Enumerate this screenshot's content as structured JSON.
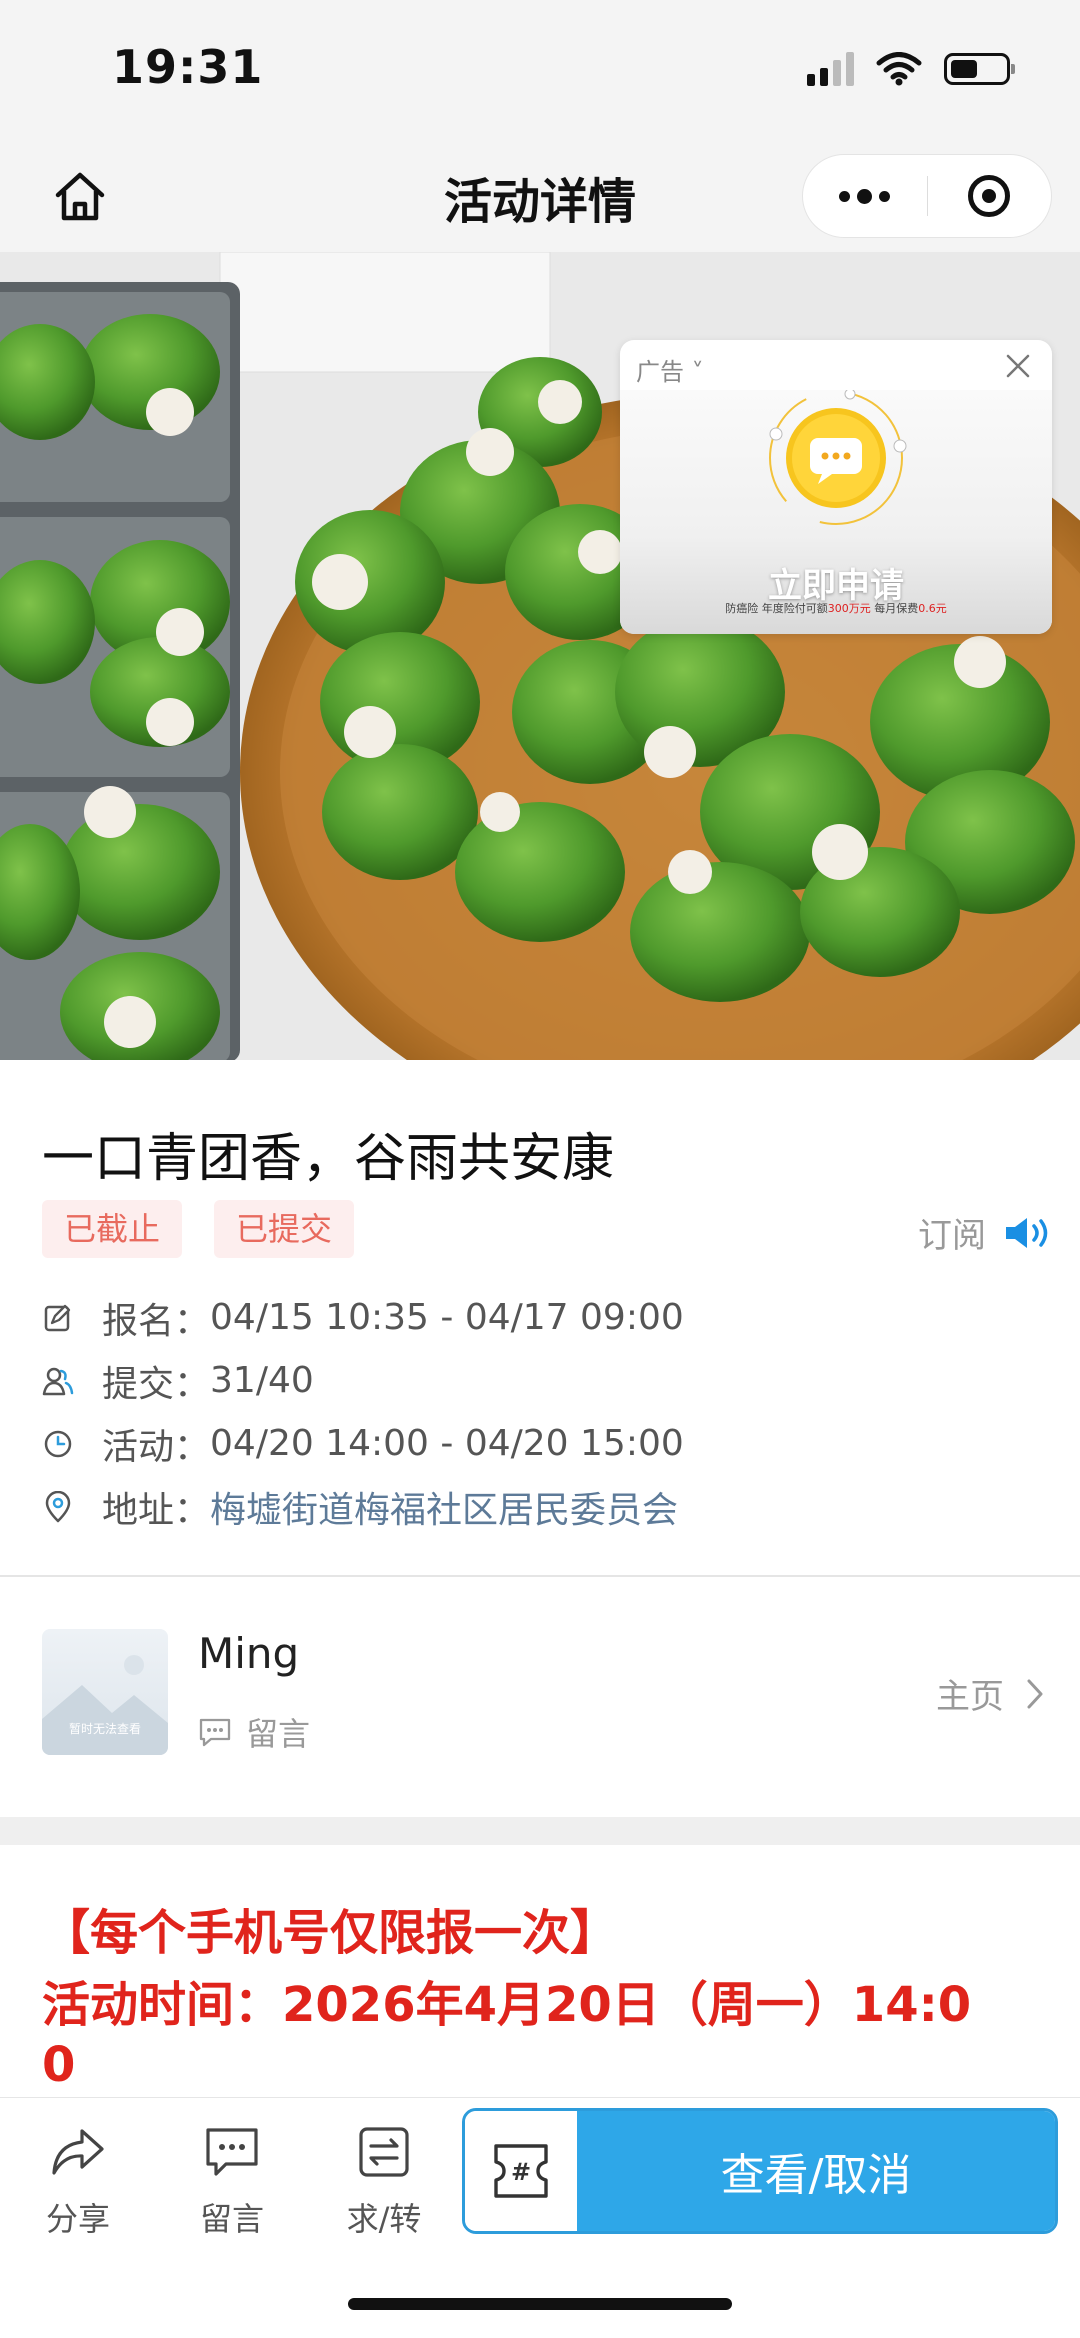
{
  "status_bar": {
    "time": "19:31"
  },
  "nav": {
    "title": "活动详情"
  },
  "ad": {
    "tag": "广告",
    "cta": "立即申请",
    "fine_print_a": "防癌险 年度险付可额",
    "fine_print_amount": "300万元",
    "fine_print_b": " 每月保费",
    "fine_print_fee": "0.6元"
  },
  "event": {
    "title": "一口青团香，谷雨共安康",
    "tags": [
      "已截止",
      "已提交"
    ],
    "subscribe_label": "订阅",
    "rows": [
      {
        "label": "报名：",
        "value": "04/15 10:35 - 04/17 09:00",
        "icon": "edit-icon"
      },
      {
        "label": "提交：",
        "value": "31/40",
        "icon": "people-icon"
      },
      {
        "label": "活动：",
        "value": "04/20 14:00 - 04/20 15:00",
        "icon": "clock-icon"
      },
      {
        "label": "地址：",
        "value": "梅墟街道梅福社区居民委员会",
        "icon": "location-icon"
      }
    ]
  },
  "organizer": {
    "avatar_text": "暂时无法查看",
    "name": "Ming",
    "message_label": "留言",
    "homepage_label": "主页"
  },
  "notice": {
    "lines": [
      "【每个手机号仅限报一次】",
      "活动时间：2026年4月20日（周一）14:0",
      "0"
    ]
  },
  "toolbar": {
    "share_label": "分享",
    "comment_label": "留言",
    "transfer_label": "求/转",
    "primary_label": "查看/取消"
  },
  "colors": {
    "accent": "#2ea7e8",
    "notice_red": "#e0241c",
    "tag_red": "#e86a5e",
    "link": "#5d7a98"
  }
}
